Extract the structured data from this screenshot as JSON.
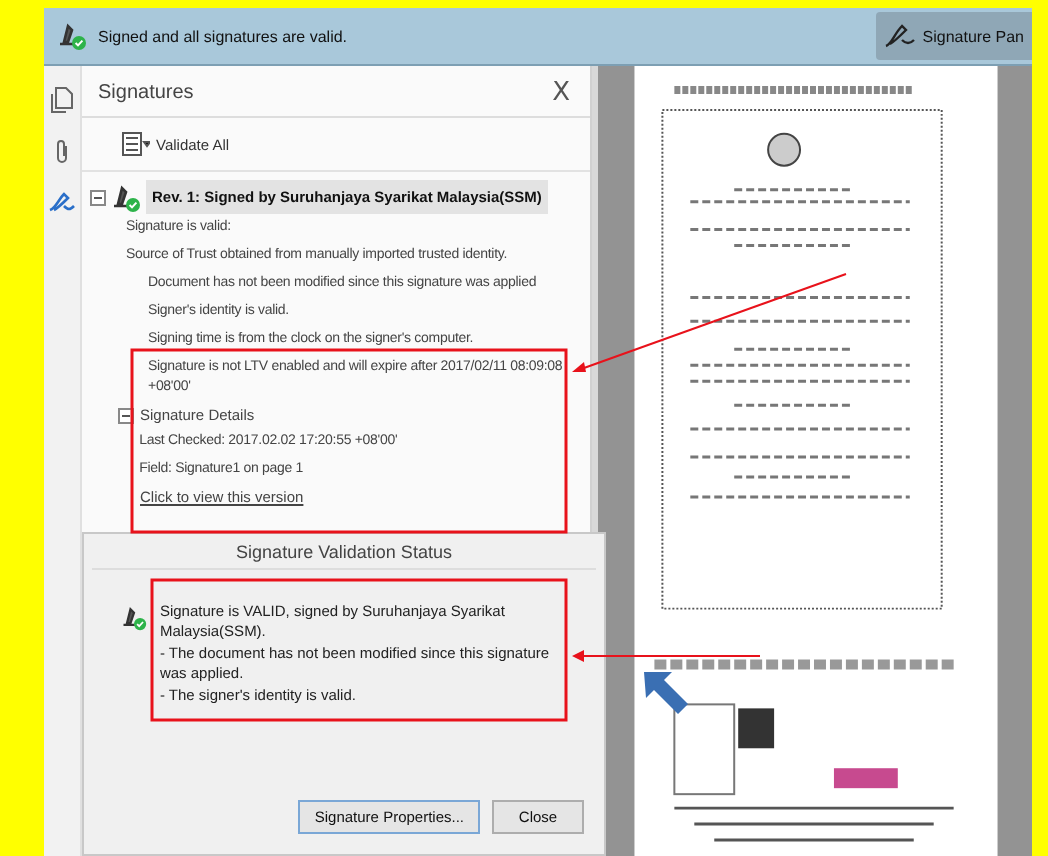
{
  "notification_bar": {
    "message": "Signed and all signatures are valid.",
    "button": "Signature Pan"
  },
  "signatures_panel": {
    "title": "Signatures",
    "close": "X",
    "validate_all": "Validate All",
    "signature": {
      "label": "Rev. 1: Signed by Suruhanjaya Syarikat Malaysia(SSM)",
      "selected": true,
      "expanded": true,
      "children": [
        {
          "text": "Signature is valid:"
        },
        {
          "text": "Source of Trust obtained from manually imported trusted identity.",
          "children": [
            {
              "text": "Document has not been modified since this signature was applied"
            },
            {
              "text": "Signer's identity is valid."
            },
            {
              "text": "Signing time is from the clock on the signer's computer."
            },
            {
              "text": "Signature is not LTV enabled and will expire after 2017/02/11 08:09:08 +08'00'"
            }
          ]
        }
      ]
    },
    "details": {
      "label": "Signature Details",
      "expanded": true,
      "lines": [
        "Last Checked: 2017.02.02 17:20:55 +08'00'",
        "Field: Signature1 on page 1"
      ],
      "link": "Click to view this version"
    }
  },
  "validation_dialog": {
    "title": "Signature Validation Status",
    "messages": [
      "Signature is VALID, signed by Suruhanjaya Syarikat Malaysia(SSM).",
      "- The document has not been modified since this signature was applied.",
      "- The signer's identity is valid."
    ],
    "buttons": [
      {
        "label": "Signature Properties...",
        "kind": "default"
      },
      {
        "label": "Close",
        "kind": "normal"
      }
    ]
  }
}
